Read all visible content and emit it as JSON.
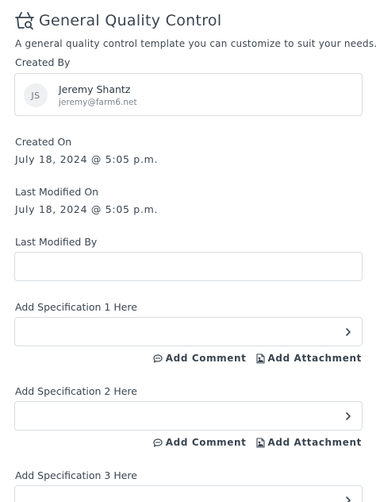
{
  "header": {
    "title": "General Quality Control",
    "subtitle": "A general quality control template you can customize to suit your needs."
  },
  "created_by": {
    "label": "Created By",
    "initials": "JS",
    "name": "Jeremy Shantz",
    "email": "jeremy@farm6.net"
  },
  "created_on": {
    "label": "Created On",
    "value": "July 18, 2024 @ 5:05 p.m."
  },
  "last_modified_on": {
    "label": "Last Modified On",
    "value": "July 18, 2024 @ 5:05 p.m."
  },
  "last_modified_by": {
    "label": "Last Modified By",
    "value": ""
  },
  "specifications": [
    {
      "label": "Add Specification 1 Here",
      "add_comment": "Add Comment",
      "add_attachment": "Add Attachment"
    },
    {
      "label": "Add Specification 2 Here",
      "add_comment": "Add Comment",
      "add_attachment": "Add Attachment"
    },
    {
      "label": "Add Specification 3 Here"
    }
  ],
  "icons": {
    "logo": "basket-search-icon",
    "chevron": "chevron-right-icon",
    "comment": "comment-icon",
    "attachment": "image-file-icon"
  }
}
